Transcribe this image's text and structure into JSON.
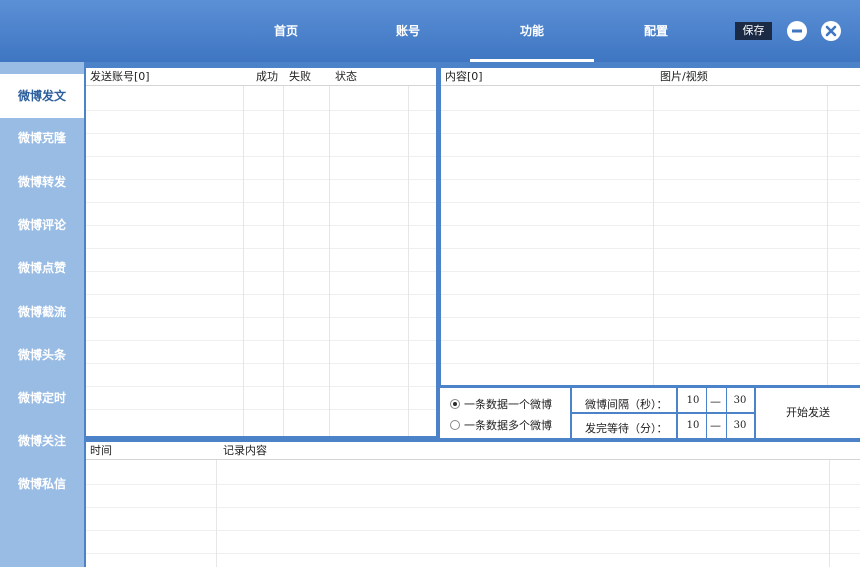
{
  "nav": {
    "items": [
      {
        "label": "首页",
        "active": false
      },
      {
        "label": "账号",
        "active": false
      },
      {
        "label": "功能",
        "active": true
      },
      {
        "label": "配置",
        "active": false
      }
    ],
    "save_label": "保存",
    "minimize_icon": "minus-circle-icon",
    "close_icon": "close-circle-icon"
  },
  "sidebar": {
    "items": [
      {
        "label": "微博发文",
        "active": true
      },
      {
        "label": "微博克隆",
        "active": false
      },
      {
        "label": "微博转发",
        "active": false
      },
      {
        "label": "微博评论",
        "active": false
      },
      {
        "label": "微博点赞",
        "active": false
      },
      {
        "label": "微博截流",
        "active": false
      },
      {
        "label": "微博头条",
        "active": false
      },
      {
        "label": "微博定时",
        "active": false
      },
      {
        "label": "微博关注",
        "active": false
      },
      {
        "label": "微博私信",
        "active": false
      }
    ]
  },
  "accounts_table": {
    "columns": [
      "发送账号[0]",
      "成功",
      "失败",
      "状态"
    ],
    "rows": []
  },
  "content_table": {
    "columns": [
      "内容[0]",
      "图片/视频"
    ],
    "rows": []
  },
  "log_table": {
    "columns": [
      "时间",
      "记录内容"
    ],
    "rows": []
  },
  "controls": {
    "mode_options": [
      {
        "label": "一条数据一个微博",
        "selected": true
      },
      {
        "label": "一条数据多个微博",
        "selected": false
      }
    ],
    "interval_label": "微博间隔（秒）：",
    "interval_min": "10",
    "interval_max": "30",
    "wait_label": "发完等待（分）：",
    "wait_min": "10",
    "wait_max": "30",
    "range_sep": "—",
    "start_label": "开始发送"
  },
  "colors": {
    "topbar": "#4a82cc",
    "sidebar": "#99bce4",
    "accent": "#4b82c8",
    "save_button": "#1b2a45"
  }
}
